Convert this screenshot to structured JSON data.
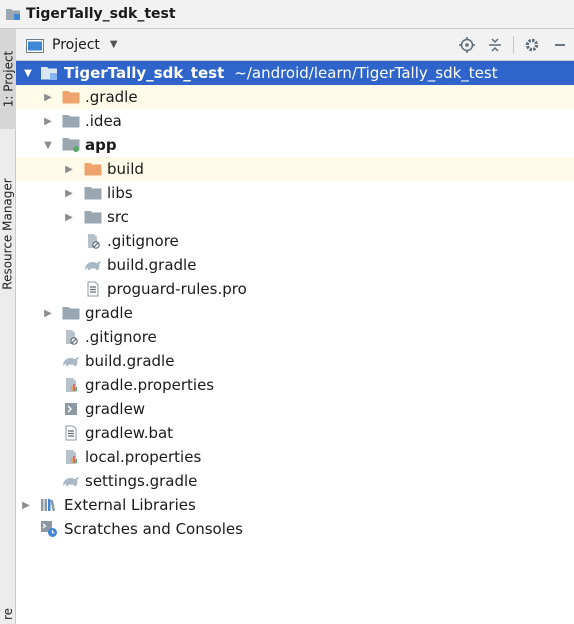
{
  "window": {
    "title": "TigerTally_sdk_test"
  },
  "side_tabs": {
    "project": "1: Project",
    "resource_manager": "Resource Manager",
    "bottom": "re"
  },
  "header": {
    "view_label": "Project",
    "tools": [
      "locate-icon",
      "collapse-all-icon",
      "gear-icon",
      "minimize-icon"
    ]
  },
  "tree": {
    "root": {
      "name": "TigerTally_sdk_test",
      "path": "~/android/learn/TigerTally_sdk_test"
    },
    "items": [
      {
        "label": ".gradle",
        "icon": "folder-orange-icon"
      },
      {
        "label": ".idea",
        "icon": "folder-icon"
      },
      {
        "label": "app",
        "icon": "module-folder-icon"
      },
      {
        "label": "build",
        "icon": "folder-orange-icon"
      },
      {
        "label": "libs",
        "icon": "folder-icon"
      },
      {
        "label": "src",
        "icon": "folder-icon"
      },
      {
        "label": ".gitignore",
        "icon": "ignored-file-icon"
      },
      {
        "label": "build.gradle",
        "icon": "gradle-icon"
      },
      {
        "label": "proguard-rules.pro",
        "icon": "text-file-icon"
      },
      {
        "label": "gradle",
        "icon": "folder-icon"
      },
      {
        "label": ".gitignore",
        "icon": "ignored-file-icon"
      },
      {
        "label": "build.gradle",
        "icon": "gradle-icon"
      },
      {
        "label": "gradle.properties",
        "icon": "properties-file-icon"
      },
      {
        "label": "gradlew",
        "icon": "shell-script-icon"
      },
      {
        "label": "gradlew.bat",
        "icon": "text-file-icon"
      },
      {
        "label": "local.properties",
        "icon": "properties-file-icon"
      },
      {
        "label": "settings.gradle",
        "icon": "gradle-icon"
      },
      {
        "label": "External Libraries",
        "icon": "library-icon"
      },
      {
        "label": "Scratches and Consoles",
        "icon": "scratches-icon"
      }
    ]
  },
  "colors": {
    "selection": "#2f65ca",
    "excluded_highlight": "#fefce8",
    "folder": "#9aa7b0",
    "excluded_folder": "#f0a46d",
    "gradle": "#a9b8c2",
    "module_dot": "#59a869"
  }
}
